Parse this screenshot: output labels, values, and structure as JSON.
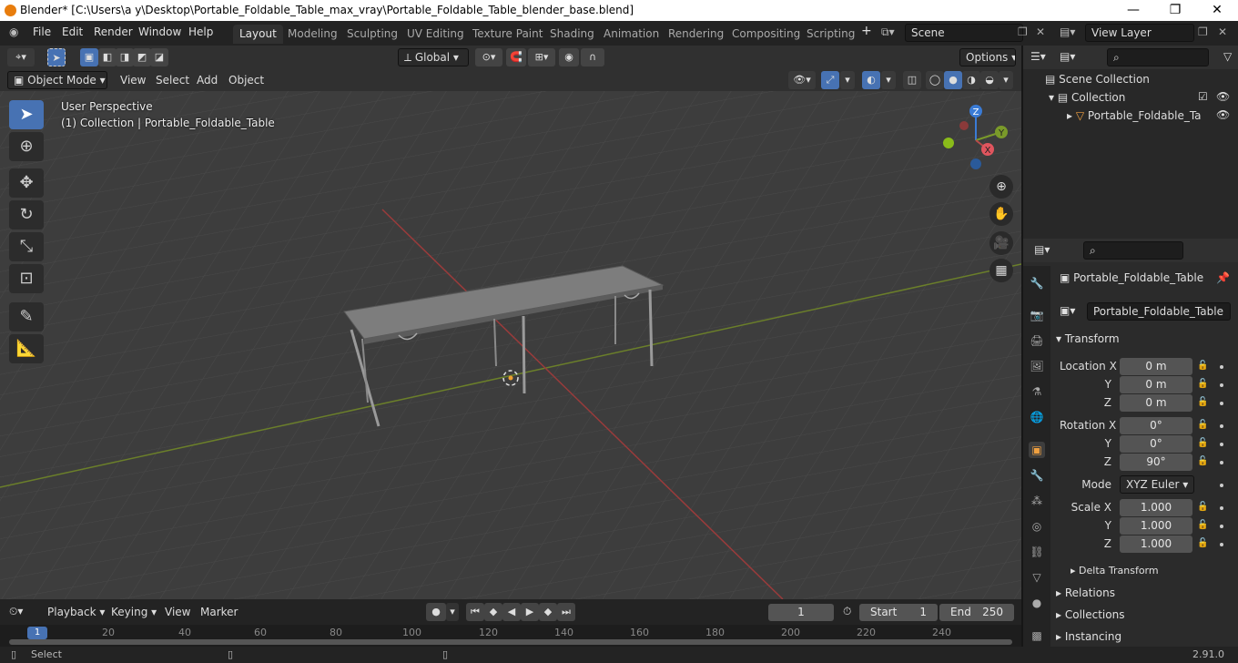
{
  "window": {
    "title": "Blender* [C:\\Users\\a y\\Desktop\\Portable_Foldable_Table_max_vray\\Portable_Foldable_Table_blender_base.blend]",
    "controls": [
      "—",
      "❐",
      "✕"
    ]
  },
  "menubar": {
    "items": [
      "File",
      "Edit",
      "Render",
      "Window",
      "Help"
    ]
  },
  "workspaces": {
    "tabs": [
      "Layout",
      "Modeling",
      "Sculpting",
      "UV Editing",
      "Texture Paint",
      "Shading",
      "Animation",
      "Rendering",
      "Compositing",
      "Scripting"
    ],
    "active": "Layout",
    "add": "+"
  },
  "scene": {
    "name": "Scene",
    "view_layer": "View Layer"
  },
  "viewport_header": {
    "transform_orientation": "Global",
    "options_label": "Options",
    "mode": "Object Mode",
    "menus": [
      "View",
      "Select",
      "Add",
      "Object"
    ]
  },
  "viewport_overlay": {
    "perspective": "User Perspective",
    "collection_info": "(1) Collection | Portable_Foldable_Table"
  },
  "gizmo": {
    "x": "X",
    "y": "Y",
    "z": "Z"
  },
  "outliner": {
    "scene_collection": "Scene Collection",
    "collection": "Collection",
    "object": "Portable_Foldable_Ta"
  },
  "properties": {
    "object_name": "Portable_Foldable_Table",
    "datablock_name": "Portable_Foldable_Table",
    "transform_label": "Transform",
    "location": {
      "label": "Location X",
      "x": "0 m",
      "y": "0 m",
      "z": "0 m"
    },
    "rotation": {
      "label": "Rotation X",
      "x": "0°",
      "y": "0°",
      "z": "90°"
    },
    "mode_label": "Mode",
    "mode_value": "XYZ Euler",
    "scale": {
      "label": "Scale X",
      "x": "1.000",
      "y": "1.000",
      "z": "1.000"
    },
    "axis_y": "Y",
    "axis_z": "Z",
    "sections": [
      "Delta Transform",
      "Relations",
      "Collections",
      "Instancing"
    ]
  },
  "timeline": {
    "menus": [
      "Playback",
      "Keying",
      "View",
      "Marker"
    ],
    "current_frame": "1",
    "start_label": "Start",
    "start": "1",
    "end_label": "End",
    "end": "250",
    "ruler": [
      "1",
      "20",
      "40",
      "60",
      "80",
      "100",
      "120",
      "140",
      "160",
      "180",
      "200",
      "220",
      "240"
    ]
  },
  "statusbar": {
    "left": "Select",
    "version": "2.91.0"
  },
  "colors": {
    "accent": "#4772b3",
    "x_axis": "#b84a4a",
    "y_axis": "#7a9a2a",
    "z_axis": "#3a7bd5"
  }
}
